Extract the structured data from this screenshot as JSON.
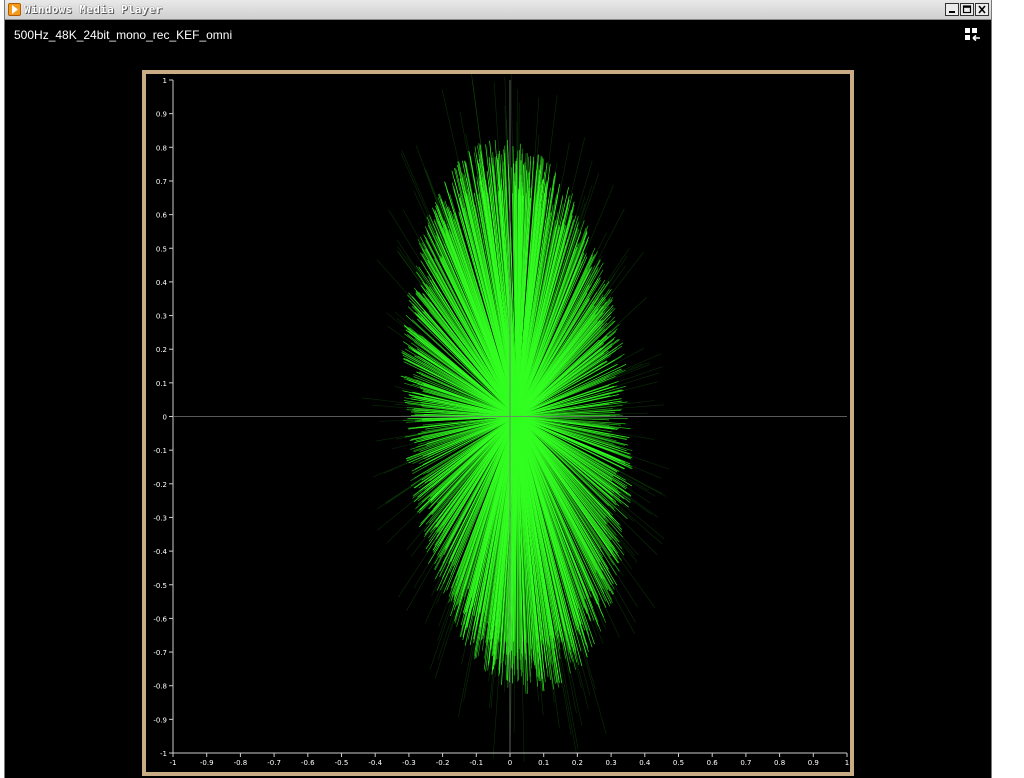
{
  "window": {
    "title": "Windows Media Player",
    "buttons": {
      "minimize": "_",
      "maximize": "□",
      "close": "×"
    }
  },
  "media": {
    "title": "500Hz_48K_24bit_mono_rec_KEF_omni"
  },
  "colors": {
    "trace": "#33ff22",
    "frame": "#c9ab86",
    "axis": "#cccccc",
    "background": "#000000"
  },
  "chart_data": {
    "type": "scatter",
    "title": "",
    "xlabel": "",
    "ylabel": "",
    "xlim": [
      -1,
      1
    ],
    "ylim": [
      -1,
      1
    ],
    "grid": false,
    "x_ticks": [
      "-1",
      "-0.9",
      "-0.8",
      "-0.7",
      "-0.6",
      "-0.5",
      "-0.4",
      "-0.3",
      "-0.2",
      "-0.1",
      "0",
      "0.1",
      "0.2",
      "0.3",
      "0.4",
      "0.5",
      "0.6",
      "0.7",
      "0.8",
      "0.9",
      "1"
    ],
    "y_ticks": [
      "1",
      "0.9",
      "0.8",
      "0.7",
      "0.6",
      "0.5",
      "0.4",
      "0.3",
      "0.2",
      "0.1",
      "0",
      "-0.1",
      "-0.2",
      "-0.3",
      "-0.4",
      "-0.5",
      "-0.6",
      "-0.7",
      "-0.8",
      "-0.9",
      "-1"
    ],
    "envelope": {
      "center_x": 0.02,
      "center_y": 0,
      "radius_x": 0.34,
      "radius_y": 0.83,
      "tilt_deg": -4
    }
  }
}
